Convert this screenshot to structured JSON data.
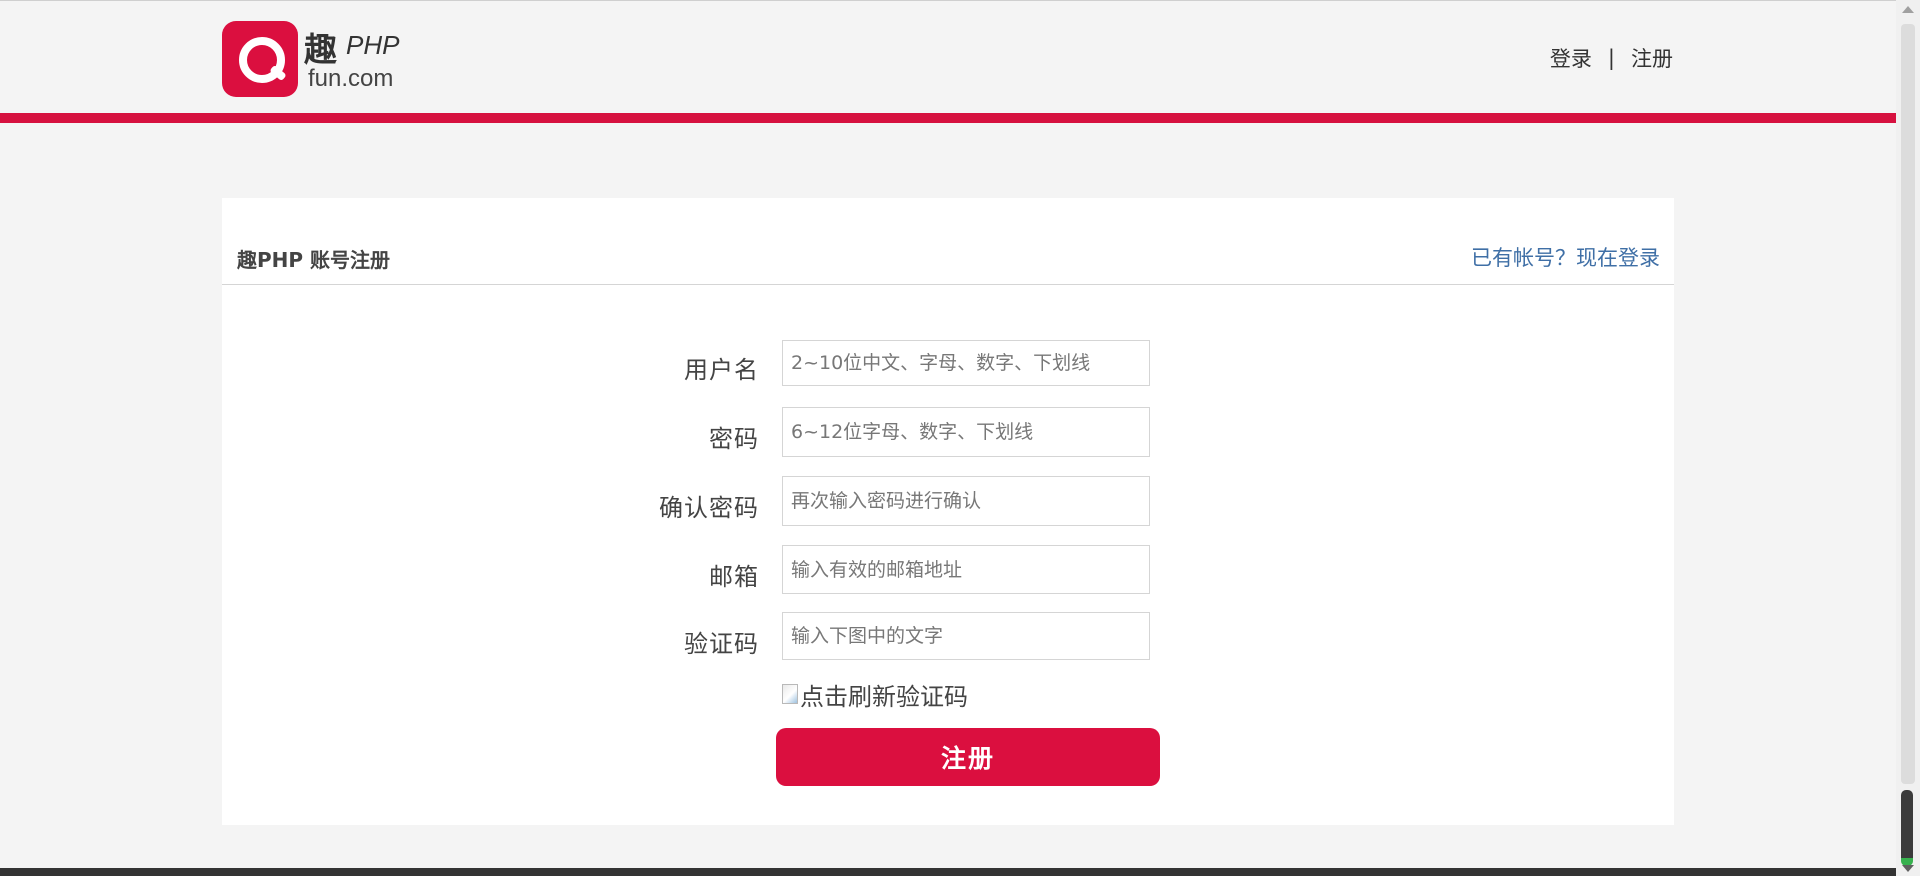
{
  "header": {
    "logo": {
      "cn_text": "趣",
      "php_text": "PHP",
      "domain_text": "fun.com",
      "badge_color": "#db0f3f",
      "icon": "q-logo-icon"
    },
    "login_link": "登录",
    "separator": "|",
    "register_link": "注册",
    "accent_bar_color": "#d6113f"
  },
  "panel": {
    "title": "趣PHP 账号注册",
    "login_prompt": "已有帐号？现在登录",
    "fields": [
      {
        "label": "用户名",
        "placeholder": "2~10位中文、字母、数字、下划线",
        "value": ""
      },
      {
        "label": "密码",
        "placeholder": "6~12位字母、数字、下划线",
        "value": ""
      },
      {
        "label": "确认密码",
        "placeholder": "再次输入密码进行确认",
        "value": ""
      },
      {
        "label": "邮箱",
        "placeholder": "输入有效的邮箱地址",
        "value": ""
      },
      {
        "label": "验证码",
        "placeholder": "输入下图中的文字",
        "value": ""
      }
    ],
    "captcha_alt": "点击刷新验证码",
    "captcha_icon": "broken-image-icon",
    "submit_label": "注册",
    "submit_color": "#db0f3f",
    "link_color": "#3f6fa6"
  }
}
